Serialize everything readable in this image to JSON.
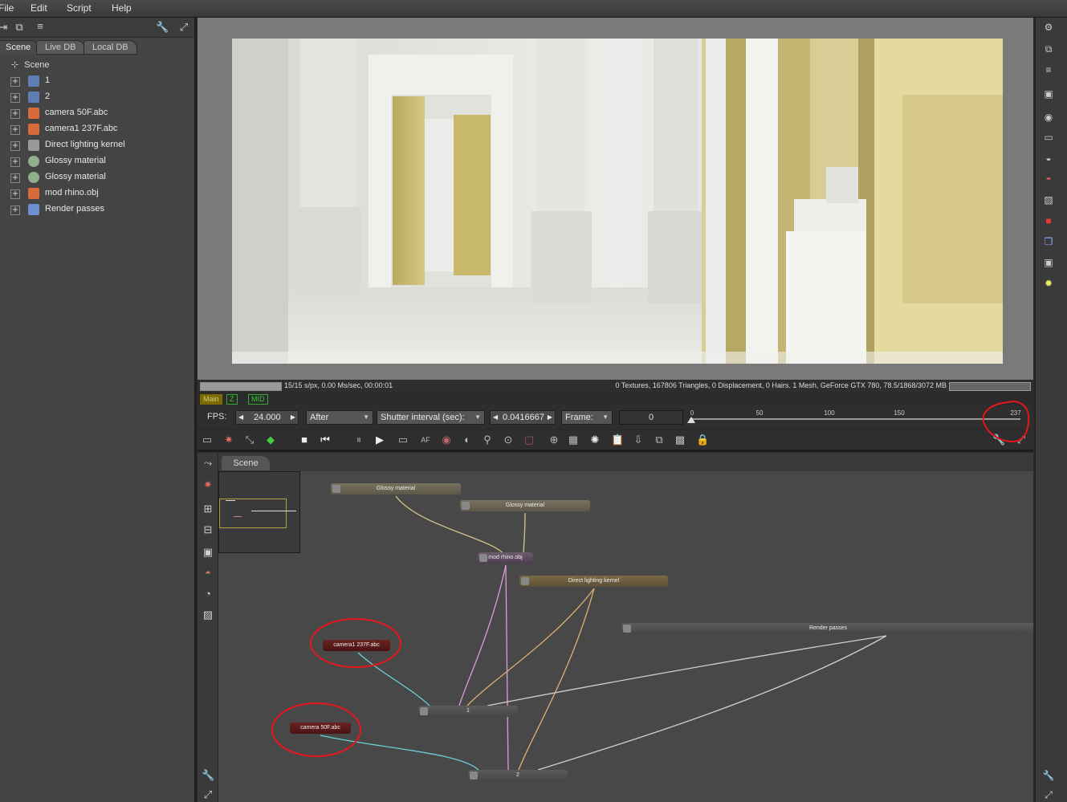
{
  "menu": [
    "File",
    "Edit",
    "Script",
    "Help"
  ],
  "left_panel": {
    "tabs": [
      "Scene",
      "Live DB",
      "Local DB"
    ],
    "tree_root": "Scene",
    "items": [
      {
        "label": "1",
        "icon": "image-icon"
      },
      {
        "label": "2",
        "icon": "image-icon"
      },
      {
        "label": "camera 50F.abc",
        "icon": "mesh-icon"
      },
      {
        "label": "camera1 237F.abc",
        "icon": "mesh-icon"
      },
      {
        "label": "Direct lighting kernel",
        "icon": "kernel-icon"
      },
      {
        "label": "Glossy material",
        "icon": "material-sphere-icon"
      },
      {
        "label": "Glossy material",
        "icon": "material-sphere-icon"
      },
      {
        "label": "mod rhino.obj",
        "icon": "mesh-icon"
      },
      {
        "label": "Render passes",
        "icon": "render-passes-icon"
      }
    ]
  },
  "status": {
    "left": "15/15 s/px, 0.00 Ms/sec, 00:00:01",
    "right": "0 Textures, 167806 Triangles, 0 Displacement, 0 Hairs. 1 Mesh, GeForce GTX 780, 78.5/1868/3072 MB",
    "progress": 1.0
  },
  "pass_tabs": [
    "Main",
    "Z",
    "MID"
  ],
  "timebar": {
    "fps_label": "FPS:",
    "fps_value": "24.000",
    "mode": "After",
    "shutter_label": "Shutter interval (sec):",
    "shutter_value": "0.0416667",
    "frame_label": "Frame:",
    "frame_value": "0",
    "ticks": [
      "0",
      "50",
      "100",
      "150",
      "237"
    ]
  },
  "graph": {
    "tab": "Scene",
    "nodes": {
      "glossy1": "Glossy material",
      "glossy2": "Glossy material",
      "rhino": "mod rhino.obj",
      "kernel": "Direct lighting kernel",
      "passes": "Render passes",
      "cam1": "camera1 237F.abc",
      "cam0": "camera 50F.abc",
      "rt1": "1",
      "rt2": "2"
    }
  },
  "colors": {
    "annotation": "#e8151b",
    "pass_active": "#3fbf3f",
    "camera_node": "#5a1a1a"
  }
}
